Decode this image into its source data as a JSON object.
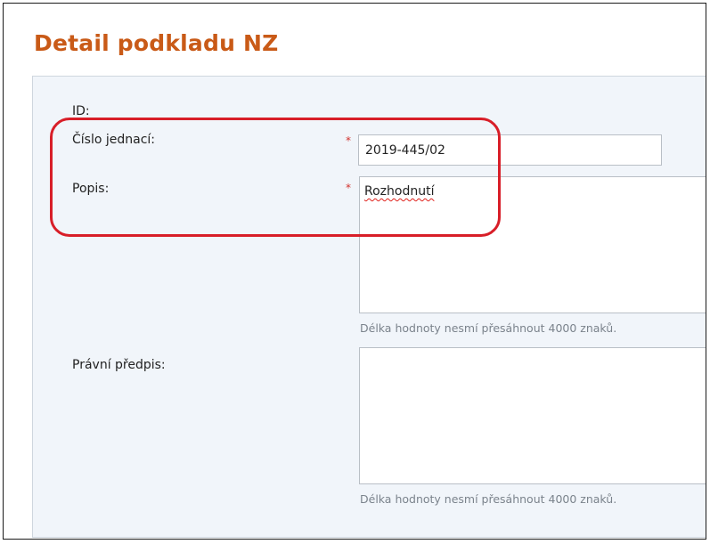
{
  "page": {
    "title": "Detail podkladu NZ"
  },
  "form": {
    "id_label": "ID:",
    "case_number": {
      "label": "Číslo jednací:",
      "required_mark": "*",
      "value": "2019-445/02"
    },
    "description": {
      "label": "Popis:",
      "required_mark": "*",
      "value": "Rozhodnutí",
      "hint": "Délka hodnoty nesmí přesáhnout 4000 znaků."
    },
    "legal_regulation": {
      "label": "Právní předpis:",
      "value": "",
      "hint": "Délka hodnoty nesmí přesáhnout 4000 znaků."
    }
  },
  "annotation": {
    "highlight_color": "#d81e28"
  },
  "colors": {
    "title": "#c95a17",
    "panel_background": "#f1f5fa",
    "required": "#d2322d",
    "hint_text": "#7b838c"
  }
}
